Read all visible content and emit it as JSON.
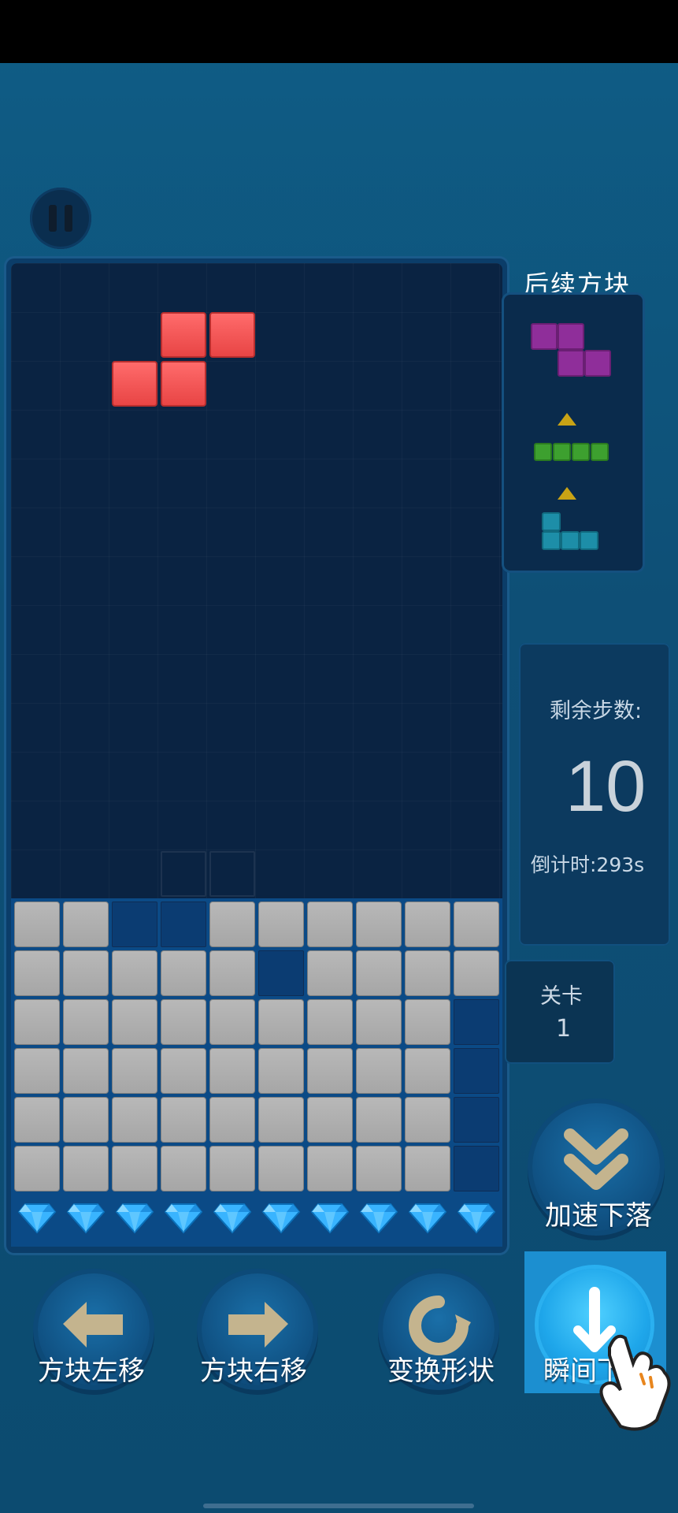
{
  "game": {
    "next_title": "后续方块",
    "steps_label": "剩余步数:",
    "steps_value": "10",
    "timer_label": "倒计时:293s",
    "level_label": "关卡",
    "level_value": "1"
  },
  "controls": {
    "speed_down": "加速下落",
    "move_left": "方块左移",
    "move_right": "方块右移",
    "rotate": "变换形状",
    "instant_drop": "瞬间下落"
  },
  "colors": {
    "piece_red": "#e84545",
    "block_gray": "#a6a6a6",
    "next_purple": "#8f2e9a",
    "next_green": "#3da02f",
    "next_teal": "#1d8ea8",
    "highlight": "#1c8fd0"
  },
  "icons": [
    "pause-icon",
    "diamond-icon",
    "double-chevron-down-icon",
    "arrow-left-icon",
    "arrow-right-icon",
    "rotate-icon",
    "hand-pointer-icon"
  ],
  "board": {
    "rows": [
      "1100111111",
      "1111101111",
      "1111111110",
      "1111111110",
      "1111111110",
      "1111111110"
    ],
    "gem_count": 10
  }
}
